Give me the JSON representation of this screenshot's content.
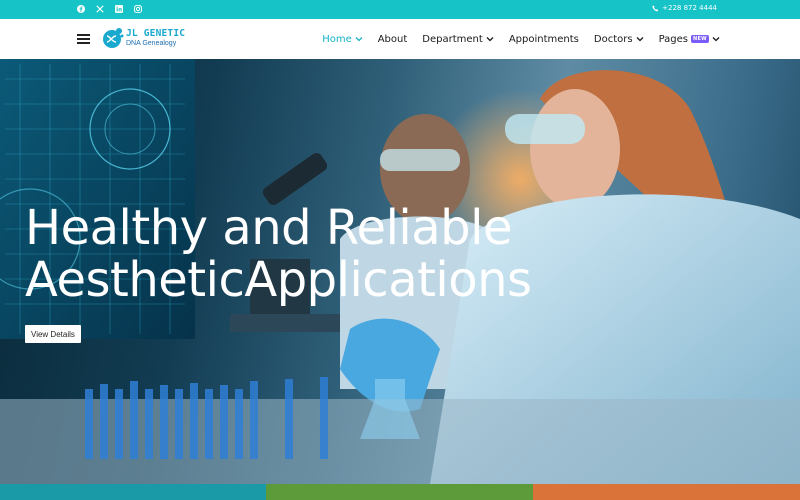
{
  "topbar": {
    "social_icons": [
      "facebook-icon",
      "x-icon",
      "linkedin-icon",
      "instagram-icon"
    ],
    "phone": "+228 872 4444",
    "bg_color": "#16c3c6"
  },
  "header": {
    "logo": {
      "title": "JL GENETIC",
      "subtitle": "DNA Genealogy"
    },
    "nav": [
      {
        "label": "Home",
        "active": true,
        "dropdown": true
      },
      {
        "label": "About",
        "active": false,
        "dropdown": false
      },
      {
        "label": "Department",
        "active": false,
        "dropdown": true
      },
      {
        "label": "Appointments",
        "active": false,
        "dropdown": false
      },
      {
        "label": "Doctors",
        "active": false,
        "dropdown": true
      },
      {
        "label": "Pages",
        "active": false,
        "dropdown": true,
        "badge": "NEW"
      }
    ],
    "accent_color": "#16b3c6",
    "badge_color": "#7b5cf5"
  },
  "hero": {
    "title_line1": "Healthy and Reliable",
    "title_line2": "AestheticApplications",
    "button_label": "View Details"
  },
  "bottom_strip_colors": [
    "#1a9aa6",
    "#5d9a3a",
    "#d9733a"
  ]
}
